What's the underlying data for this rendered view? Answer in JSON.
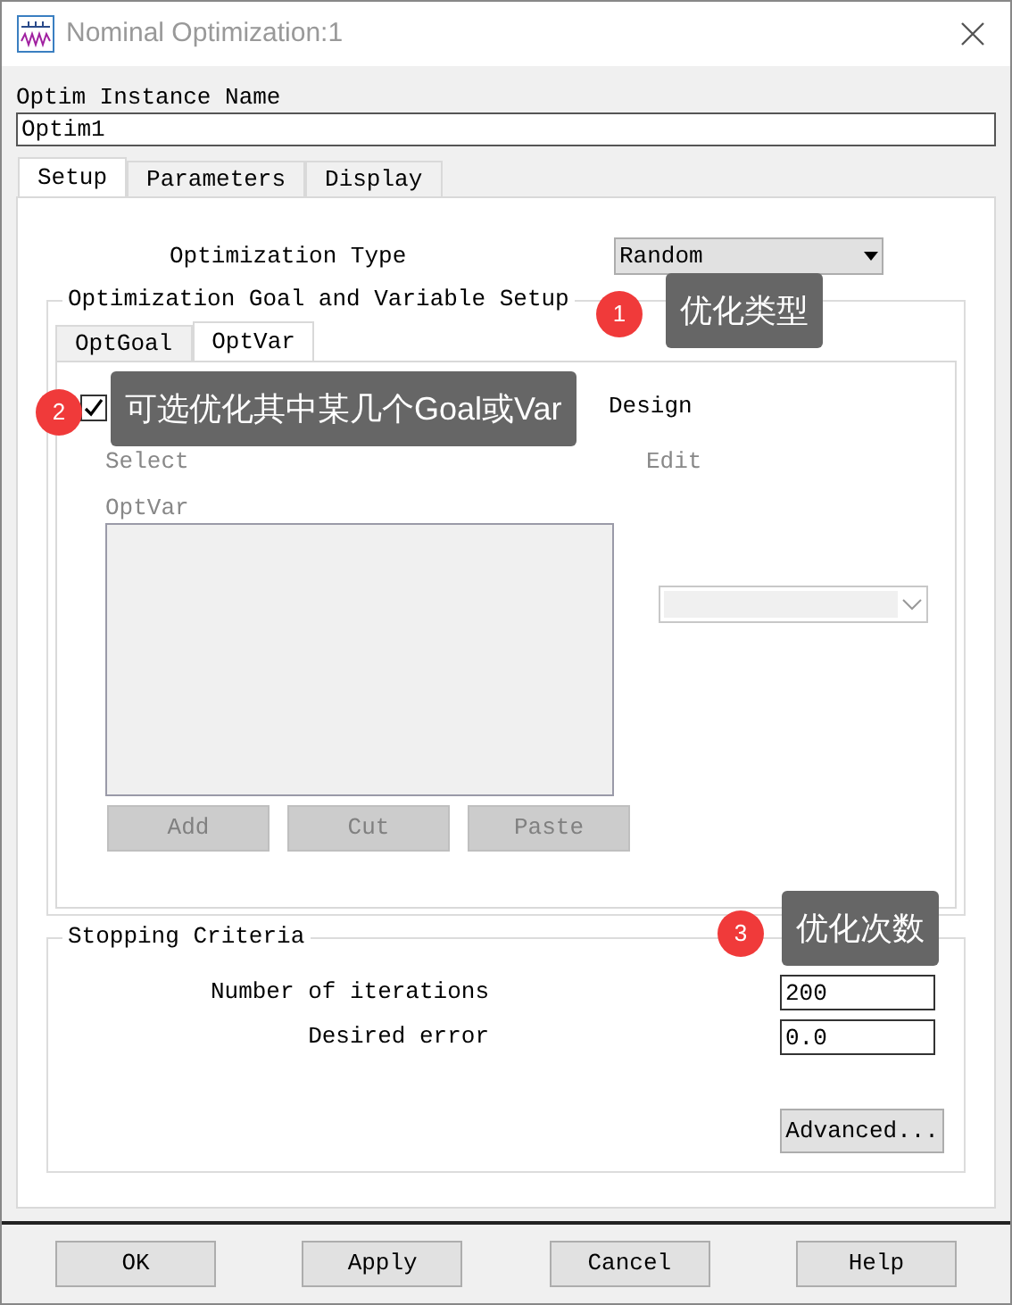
{
  "window": {
    "title": "Nominal Optimization:1"
  },
  "instance_name": {
    "label": "Optim Instance Name",
    "value": "Optim1"
  },
  "tabs": [
    {
      "label": "Setup",
      "selected": true
    },
    {
      "label": "Parameters",
      "selected": false
    },
    {
      "label": "Display",
      "selected": false
    }
  ],
  "optimization_type": {
    "label": "Optimization Type",
    "value": "Random"
  },
  "goal_variable_setup": {
    "title": "Optimization Goal and Variable Setup",
    "tabs": [
      {
        "label": "OptGoal",
        "selected": false
      },
      {
        "label": "OptVar",
        "selected": true
      }
    ],
    "checkbox": {
      "label": "Design",
      "checked": true
    },
    "select_label": "Select",
    "edit_label": "Edit",
    "list_label": "OptVar",
    "buttons": [
      {
        "label": "Add",
        "disabled": true
      },
      {
        "label": "Cut",
        "disabled": true
      },
      {
        "label": "Paste",
        "disabled": true
      }
    ]
  },
  "stopping_criteria": {
    "title": "Stopping Criteria",
    "fields": [
      {
        "label": "Number of iterations",
        "value": "200"
      },
      {
        "label": "Desired error",
        "value": "0.0"
      }
    ],
    "advanced_button": "Advanced..."
  },
  "buttons": [
    "OK",
    "Apply",
    "Cancel",
    "Help"
  ],
  "annotations": [
    {
      "number": "1",
      "text": "优化类型"
    },
    {
      "number": "2",
      "text": "可选优化其中某几个Goal或Var"
    },
    {
      "number": "3",
      "text": "优化次数"
    }
  ]
}
